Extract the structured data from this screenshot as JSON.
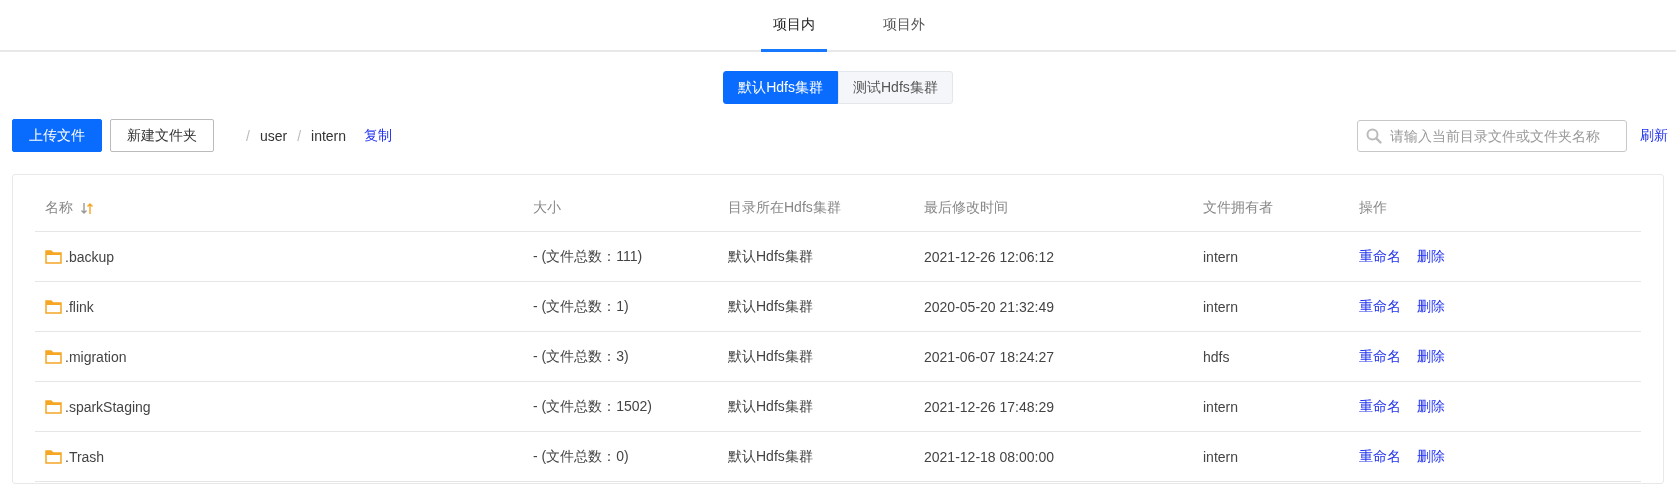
{
  "tabs": [
    {
      "label": "项目内",
      "selected": true
    },
    {
      "label": "项目外",
      "selected": false
    }
  ],
  "clusters": [
    {
      "label": "默认Hdfs集群",
      "selected": true
    },
    {
      "label": "测试Hdfs集群",
      "selected": false
    }
  ],
  "toolbar": {
    "upload": "上传文件",
    "new_folder": "新建文件夹",
    "breadcrumb": [
      {
        "separator": "/",
        "label": "user"
      },
      {
        "separator": "/",
        "label": "intern"
      }
    ],
    "copy": "复制",
    "search": {
      "placeholder": "请输入当前目录文件或文件夹名称"
    },
    "refresh": "刷新"
  },
  "table": {
    "columns": [
      "名称",
      "大小",
      "目录所在Hdfs集群",
      "最后修改时间",
      "文件拥有者",
      "操作"
    ],
    "rows": [
      {
        "name": ".backup",
        "size": "- (文件总数：111)",
        "cluster": "默认Hdfs集群",
        "modified": "2021-12-26 12:06:12",
        "owner": "intern",
        "actions": [
          "重命名",
          "删除"
        ]
      },
      {
        "name": ".flink",
        "size": "- (文件总数：1)",
        "cluster": "默认Hdfs集群",
        "modified": "2020-05-20 21:32:49",
        "owner": "intern",
        "actions": [
          "重命名",
          "删除"
        ]
      },
      {
        "name": ".migration",
        "size": "- (文件总数：3)",
        "cluster": "默认Hdfs集群",
        "modified": "2021-06-07 18:24:27",
        "owner": "hdfs",
        "actions": [
          "重命名",
          "删除"
        ]
      },
      {
        "name": ".sparkStaging",
        "size": "- (文件总数：1502)",
        "cluster": "默认Hdfs集群",
        "modified": "2021-12-26 17:48:29",
        "owner": "intern",
        "actions": [
          "重命名",
          "删除"
        ]
      },
      {
        "name": ".Trash",
        "size": "- (文件总数：0)",
        "cluster": "默认Hdfs集群",
        "modified": "2021-12-18 08:00:00",
        "owner": "intern",
        "actions": [
          "重命名",
          "删除"
        ]
      }
    ]
  }
}
